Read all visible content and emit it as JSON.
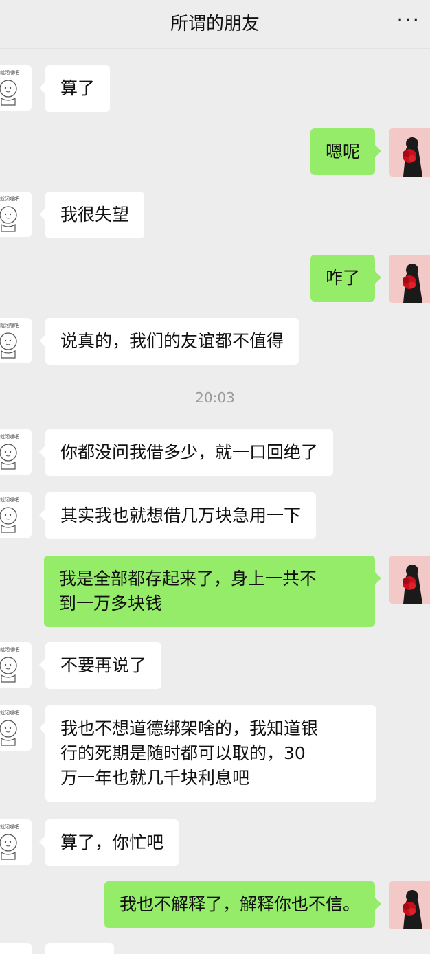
{
  "header": {
    "title": "所谓的朋友",
    "more_label": "···"
  },
  "avatar_left_caption": "就闭嘴吧",
  "timestamp": "20:03",
  "messages": [
    {
      "text": "算了"
    },
    {
      "text": "嗯呢"
    },
    {
      "text": "我很失望"
    },
    {
      "text": "咋了"
    },
    {
      "text": "说真的，我们的友谊都不值得"
    },
    {
      "text": "你都没问我借多少，就一口回绝了"
    },
    {
      "text": "其实我也就想借几万块急用一下"
    },
    {
      "text": "我是全部都存起来了，身上一共不\n到一万多块钱"
    },
    {
      "text": "不要再说了"
    },
    {
      "text": "我也不想道德绑架啥的，我知道银\n行的死期是随时都可以取的，30\n万一年也就几千块利息吧"
    },
    {
      "text": "算了，你忙吧"
    },
    {
      "text": "我也不解释了，解释你也不信。"
    }
  ]
}
